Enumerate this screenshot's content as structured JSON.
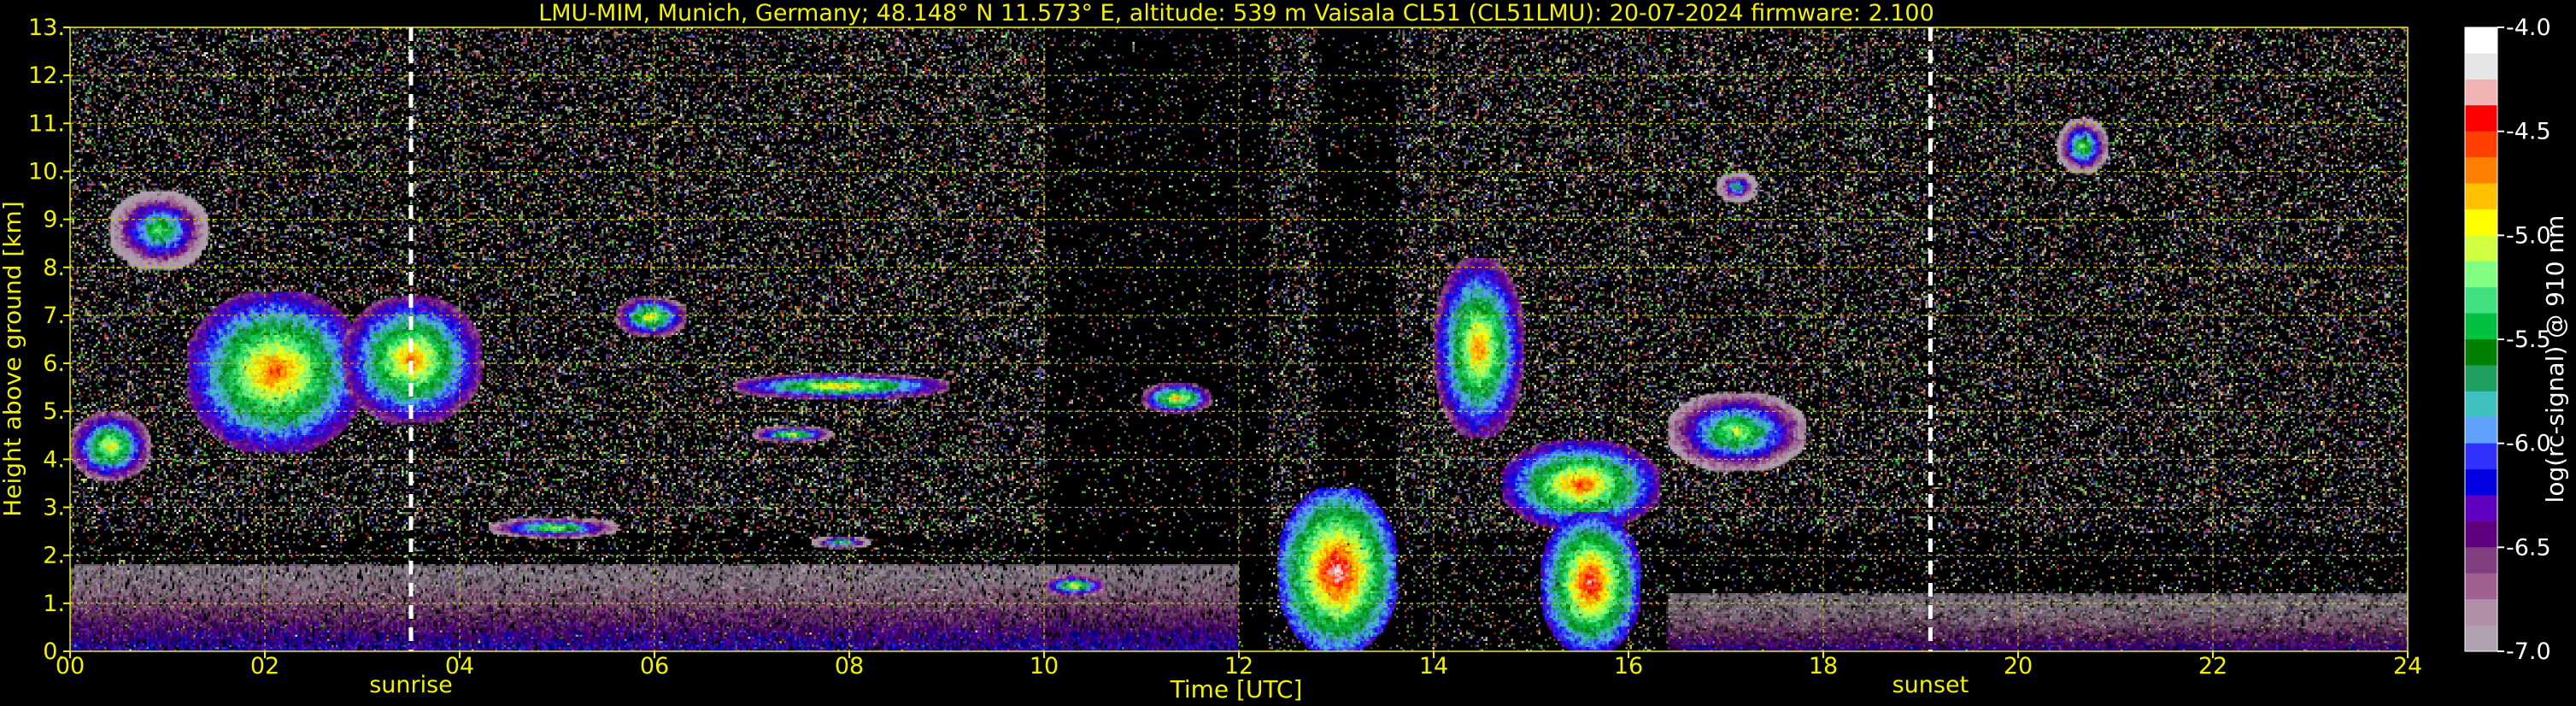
{
  "chart_data": {
    "type": "heatmap",
    "title": "LMU-MIM, Munich, Germany; 48.148° N 11.573° E, altitude: 539 m    Vaisala CL51 (CL51LMU): 20-07-2024    firmware: 2.100",
    "xlabel": "Time [UTC]",
    "ylabel": "Height above ground [km]",
    "xlim": [
      0,
      24
    ],
    "ylim": [
      0,
      13
    ],
    "x_ticks": [
      "00",
      "02",
      "04",
      "06",
      "08",
      "10",
      "12",
      "14",
      "16",
      "18",
      "20",
      "22",
      "24"
    ],
    "y_ticks": [
      "0.",
      "1.",
      "2.",
      "3.",
      "4.",
      "5.",
      "6.",
      "7.",
      "8.",
      "9.",
      "10.",
      "11.",
      "12.",
      "13."
    ],
    "grid": true,
    "markers": [
      {
        "label": "sunrise",
        "x": 3.5
      },
      {
        "label": "sunset",
        "x": 19.1
      }
    ],
    "colorbar": {
      "label": "log(rc-signal) @ 910 nm",
      "range": [
        -7.0,
        -4.0
      ],
      "ticks": [
        "-4.0",
        "-4.5",
        "-5.0",
        "-5.5",
        "-6.0",
        "-6.5",
        "-7.0"
      ],
      "colors": [
        "#ffffff",
        "#e6e6e6",
        "#f0b4b4",
        "#ff0000",
        "#ff4000",
        "#ff8000",
        "#ffc000",
        "#ffff00",
        "#d0ff40",
        "#80ff80",
        "#40e080",
        "#00c040",
        "#008000",
        "#20a060",
        "#40c0c0",
        "#60a0ff",
        "#3030ff",
        "#0000e0",
        "#6000c0",
        "#600080",
        "#804080",
        "#a06090",
        "#b090a8",
        "#b0a0b0"
      ]
    },
    "cloud_layers": [
      {
        "t0": 0.0,
        "t1": 0.8,
        "h0": 3.6,
        "h1": 5.0,
        "peak": -4.6
      },
      {
        "t0": 0.4,
        "t1": 1.4,
        "h0": 8.0,
        "h1": 9.6,
        "peak": -5.0
      },
      {
        "t0": 1.2,
        "t1": 3.0,
        "h0": 4.2,
        "h1": 7.5,
        "peak": -4.3
      },
      {
        "t0": 2.8,
        "t1": 4.2,
        "h0": 4.8,
        "h1": 7.4,
        "peak": -4.4
      },
      {
        "t0": 5.6,
        "t1": 6.3,
        "h0": 6.6,
        "h1": 7.4,
        "peak": -4.6
      },
      {
        "t0": 6.8,
        "t1": 9.0,
        "h0": 5.3,
        "h1": 5.8,
        "peak": -4.5
      },
      {
        "t0": 7.0,
        "t1": 7.8,
        "h0": 4.4,
        "h1": 4.7,
        "peak": -4.7
      },
      {
        "t0": 4.3,
        "t1": 5.6,
        "h0": 2.4,
        "h1": 2.8,
        "peak": -4.8
      },
      {
        "t0": 7.6,
        "t1": 8.2,
        "h0": 2.2,
        "h1": 2.4,
        "peak": -4.9
      },
      {
        "t0": 10.0,
        "t1": 10.6,
        "h0": 1.2,
        "h1": 1.6,
        "peak": -4.6
      },
      {
        "t0": 11.0,
        "t1": 11.7,
        "h0": 5.0,
        "h1": 5.6,
        "peak": -4.5
      },
      {
        "t0": 12.4,
        "t1": 13.6,
        "h0": 0.0,
        "h1": 3.4,
        "peak": -4.0
      },
      {
        "t0": 14.0,
        "t1": 14.9,
        "h0": 4.5,
        "h1": 8.2,
        "peak": -4.4
      },
      {
        "t0": 14.7,
        "t1": 16.3,
        "h0": 2.6,
        "h1": 4.4,
        "peak": -4.3
      },
      {
        "t0": 15.1,
        "t1": 16.1,
        "h0": 0.0,
        "h1": 2.9,
        "peak": -4.1
      },
      {
        "t0": 16.4,
        "t1": 17.8,
        "h0": 3.8,
        "h1": 5.4,
        "peak": -4.8
      },
      {
        "t0": 20.4,
        "t1": 20.9,
        "h0": 10.0,
        "h1": 11.1,
        "peak": -4.9
      },
      {
        "t0": 16.9,
        "t1": 17.3,
        "h0": 9.4,
        "h1": 10.0,
        "peak": -5.2
      }
    ],
    "boundary_layer": [
      {
        "t0": 0.0,
        "t1": 12.0,
        "h0": 0.0,
        "h1": 1.8,
        "peak": -6.0
      },
      {
        "t0": 16.4,
        "t1": 24.0,
        "h0": 0.0,
        "h1": 1.2,
        "peak": -6.1
      }
    ]
  }
}
